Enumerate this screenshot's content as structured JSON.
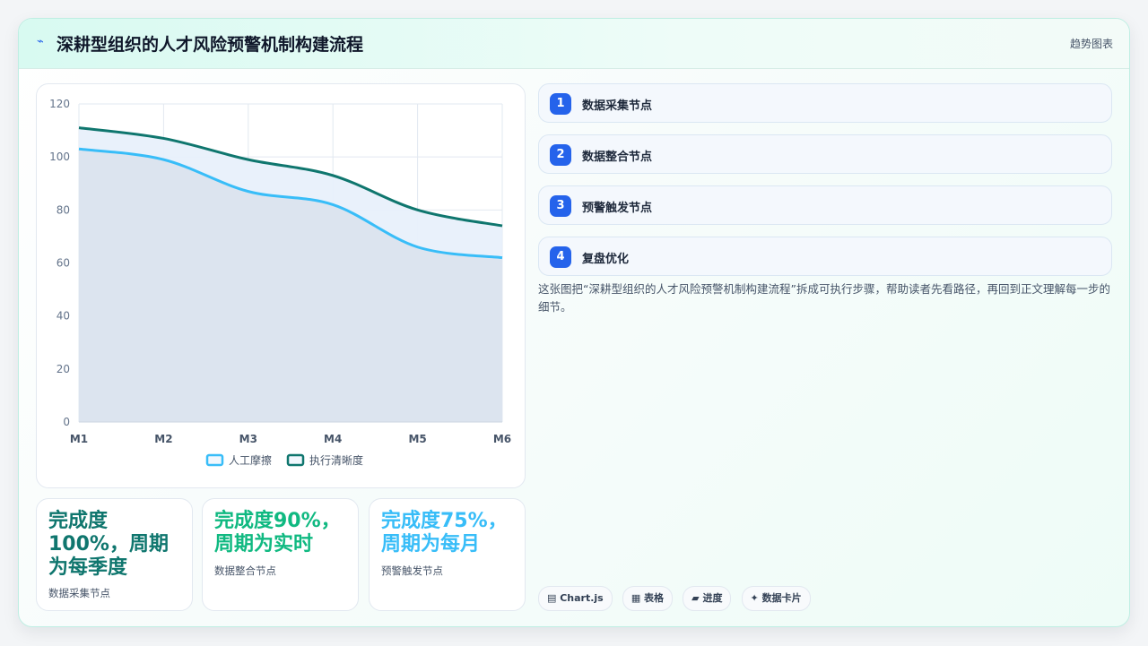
{
  "header": {
    "icon": "bolt-icon",
    "title": "深耕型组织的人才风险预警机制构建流程",
    "link": "趋势图表"
  },
  "chart_data": {
    "type": "area",
    "categories": [
      "M1",
      "M2",
      "M3",
      "M4",
      "M5",
      "M6"
    ],
    "series": [
      {
        "name": "人工摩擦",
        "values": [
          103,
          99,
          87,
          82,
          66,
          62
        ],
        "color": "#38bdf8"
      },
      {
        "name": "执行清晰度",
        "values": [
          111,
          107,
          99,
          93,
          80,
          74
        ],
        "color": "#0f766e"
      }
    ],
    "ylim": [
      0,
      120
    ],
    "yticks": [
      0,
      20,
      40,
      60,
      80,
      100,
      120
    ],
    "grid": true,
    "legend": "bottom"
  },
  "steps": [
    {
      "num": "1",
      "label": "数据采集节点"
    },
    {
      "num": "2",
      "label": "数据整合节点"
    },
    {
      "num": "3",
      "label": "预警触发节点"
    },
    {
      "num": "4",
      "label": "复盘优化"
    }
  ],
  "description": "这张图把“深耕型组织的人才风险预警机制构建流程”拆成可执行步骤，帮助读者先看路径，再回到正文理解每一步的细节。",
  "stats": [
    {
      "value": "完成度100%，周期为每季度",
      "label": "数据采集节点",
      "color": "#0f766e"
    },
    {
      "value": "完成度90%，周期为实时",
      "label": "数据整合节点",
      "color": "#10b981"
    },
    {
      "value": "完成度75%，周期为每月",
      "label": "预警触发节点",
      "color": "#38bdf8"
    }
  ],
  "tags": [
    "▤ Chart.js",
    "▦ 表格",
    "▰ 进度",
    "✦ 数据卡片"
  ]
}
